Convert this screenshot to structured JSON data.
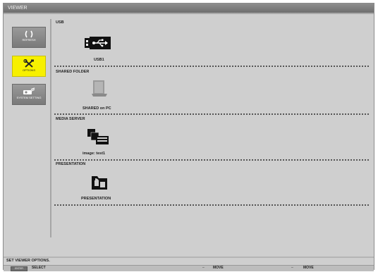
{
  "window": {
    "title": "VIEWER"
  },
  "sidebar": {
    "items": [
      {
        "label": "REFRESH",
        "icon": "refresh-icon",
        "active": false
      },
      {
        "label": "OPTIONS",
        "icon": "tools-icon",
        "active": true
      },
      {
        "label": "SYSTEM SETTING",
        "icon": "projector-icon",
        "active": false
      }
    ]
  },
  "sections": [
    {
      "title": "USB",
      "item_label": "USB1",
      "icon": "usb-icon"
    },
    {
      "title": "SHARED FOLDER",
      "item_label": "SHARED on PC",
      "icon": "shared-folder-icon"
    },
    {
      "title": "MEDIA SERVER",
      "item_label": "image: test1",
      "icon": "media-server-icon"
    },
    {
      "title": "PRESENTATION",
      "item_label": "PRESENTATION",
      "icon": "presentation-icon"
    }
  ],
  "status": {
    "message": "SET VIEWER OPTIONS."
  },
  "hints": {
    "enter_key": "ENTER",
    "select_label": "SELECT",
    "move_label_1": "MOVE",
    "move_label_2": "MOVE"
  },
  "colors": {
    "active_accent": "#f7f000",
    "background": "#cfcfcf",
    "titlebar": "#7a7a7a"
  }
}
